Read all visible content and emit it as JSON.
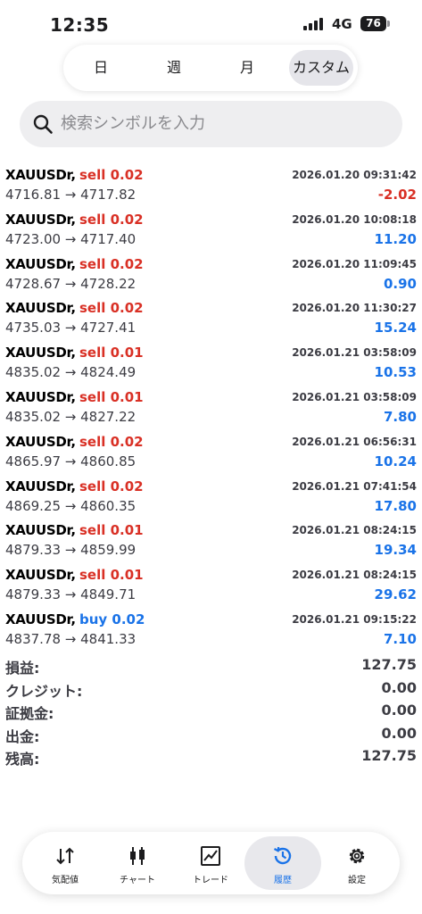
{
  "status_bar": {
    "time": "12:35",
    "network": "4G",
    "battery": "76"
  },
  "period_tabs": [
    {
      "label": "日",
      "active": false
    },
    {
      "label": "週",
      "active": false
    },
    {
      "label": "月",
      "active": false
    },
    {
      "label": "カスタム",
      "active": true
    }
  ],
  "search": {
    "placeholder": "検索シンボルを入力",
    "icon": "search-icon"
  },
  "deals": [
    {
      "symbol": "XAUUSDr,",
      "type": "sell 0.02",
      "side": "sell",
      "time": "2026.01.20 09:31:42",
      "prices": "4716.81 → 4717.82",
      "profit": "-2.02"
    },
    {
      "symbol": "XAUUSDr,",
      "type": "sell 0.02",
      "side": "sell",
      "time": "2026.01.20 10:08:18",
      "prices": "4723.00 → 4717.40",
      "profit": "11.20"
    },
    {
      "symbol": "XAUUSDr,",
      "type": "sell 0.02",
      "side": "sell",
      "time": "2026.01.20 11:09:45",
      "prices": "4728.67 → 4728.22",
      "profit": "0.90"
    },
    {
      "symbol": "XAUUSDr,",
      "type": "sell 0.02",
      "side": "sell",
      "time": "2026.01.20 11:30:27",
      "prices": "4735.03 → 4727.41",
      "profit": "15.24"
    },
    {
      "symbol": "XAUUSDr,",
      "type": "sell 0.01",
      "side": "sell",
      "time": "2026.01.21 03:58:09",
      "prices": "4835.02 → 4824.49",
      "profit": "10.53"
    },
    {
      "symbol": "XAUUSDr,",
      "type": "sell 0.01",
      "side": "sell",
      "time": "2026.01.21 03:58:09",
      "prices": "4835.02 → 4827.22",
      "profit": "7.80"
    },
    {
      "symbol": "XAUUSDr,",
      "type": "sell 0.02",
      "side": "sell",
      "time": "2026.01.21 06:56:31",
      "prices": "4865.97 → 4860.85",
      "profit": "10.24"
    },
    {
      "symbol": "XAUUSDr,",
      "type": "sell 0.02",
      "side": "sell",
      "time": "2026.01.21 07:41:54",
      "prices": "4869.25 → 4860.35",
      "profit": "17.80"
    },
    {
      "symbol": "XAUUSDr,",
      "type": "sell 0.01",
      "side": "sell",
      "time": "2026.01.21 08:24:15",
      "prices": "4879.33 → 4859.99",
      "profit": "19.34"
    },
    {
      "symbol": "XAUUSDr,",
      "type": "sell 0.01",
      "side": "sell",
      "time": "2026.01.21 08:24:15",
      "prices": "4879.33 → 4849.71",
      "profit": "29.62"
    },
    {
      "symbol": "XAUUSDr,",
      "type": "buy 0.02",
      "side": "buy",
      "time": "2026.01.21 09:15:22",
      "prices": "4837.78 → 4841.33",
      "profit": "7.10"
    }
  ],
  "summary": [
    {
      "label": "損益:",
      "value": "127.75"
    },
    {
      "label": "クレジット:",
      "value": "0.00"
    },
    {
      "label": "証拠金:",
      "value": "0.00"
    },
    {
      "label": "出金:",
      "value": "0.00"
    },
    {
      "label": "残高:",
      "value": "127.75"
    }
  ],
  "colors": {
    "sell": "#d93025",
    "buy": "#1a73e8",
    "profit_positive": "#1a73e8",
    "profit_negative": "#d93025"
  },
  "bottom_nav": [
    {
      "label": "気配値",
      "icon": "quotes-arrows-icon",
      "active": false
    },
    {
      "label": "チャート",
      "icon": "candlestick-chart-icon",
      "active": false
    },
    {
      "label": "トレード",
      "icon": "trade-chart-icon",
      "active": false
    },
    {
      "label": "履歴",
      "icon": "history-clock-icon",
      "active": true
    },
    {
      "label": "設定",
      "icon": "gear-icon",
      "active": false
    }
  ]
}
